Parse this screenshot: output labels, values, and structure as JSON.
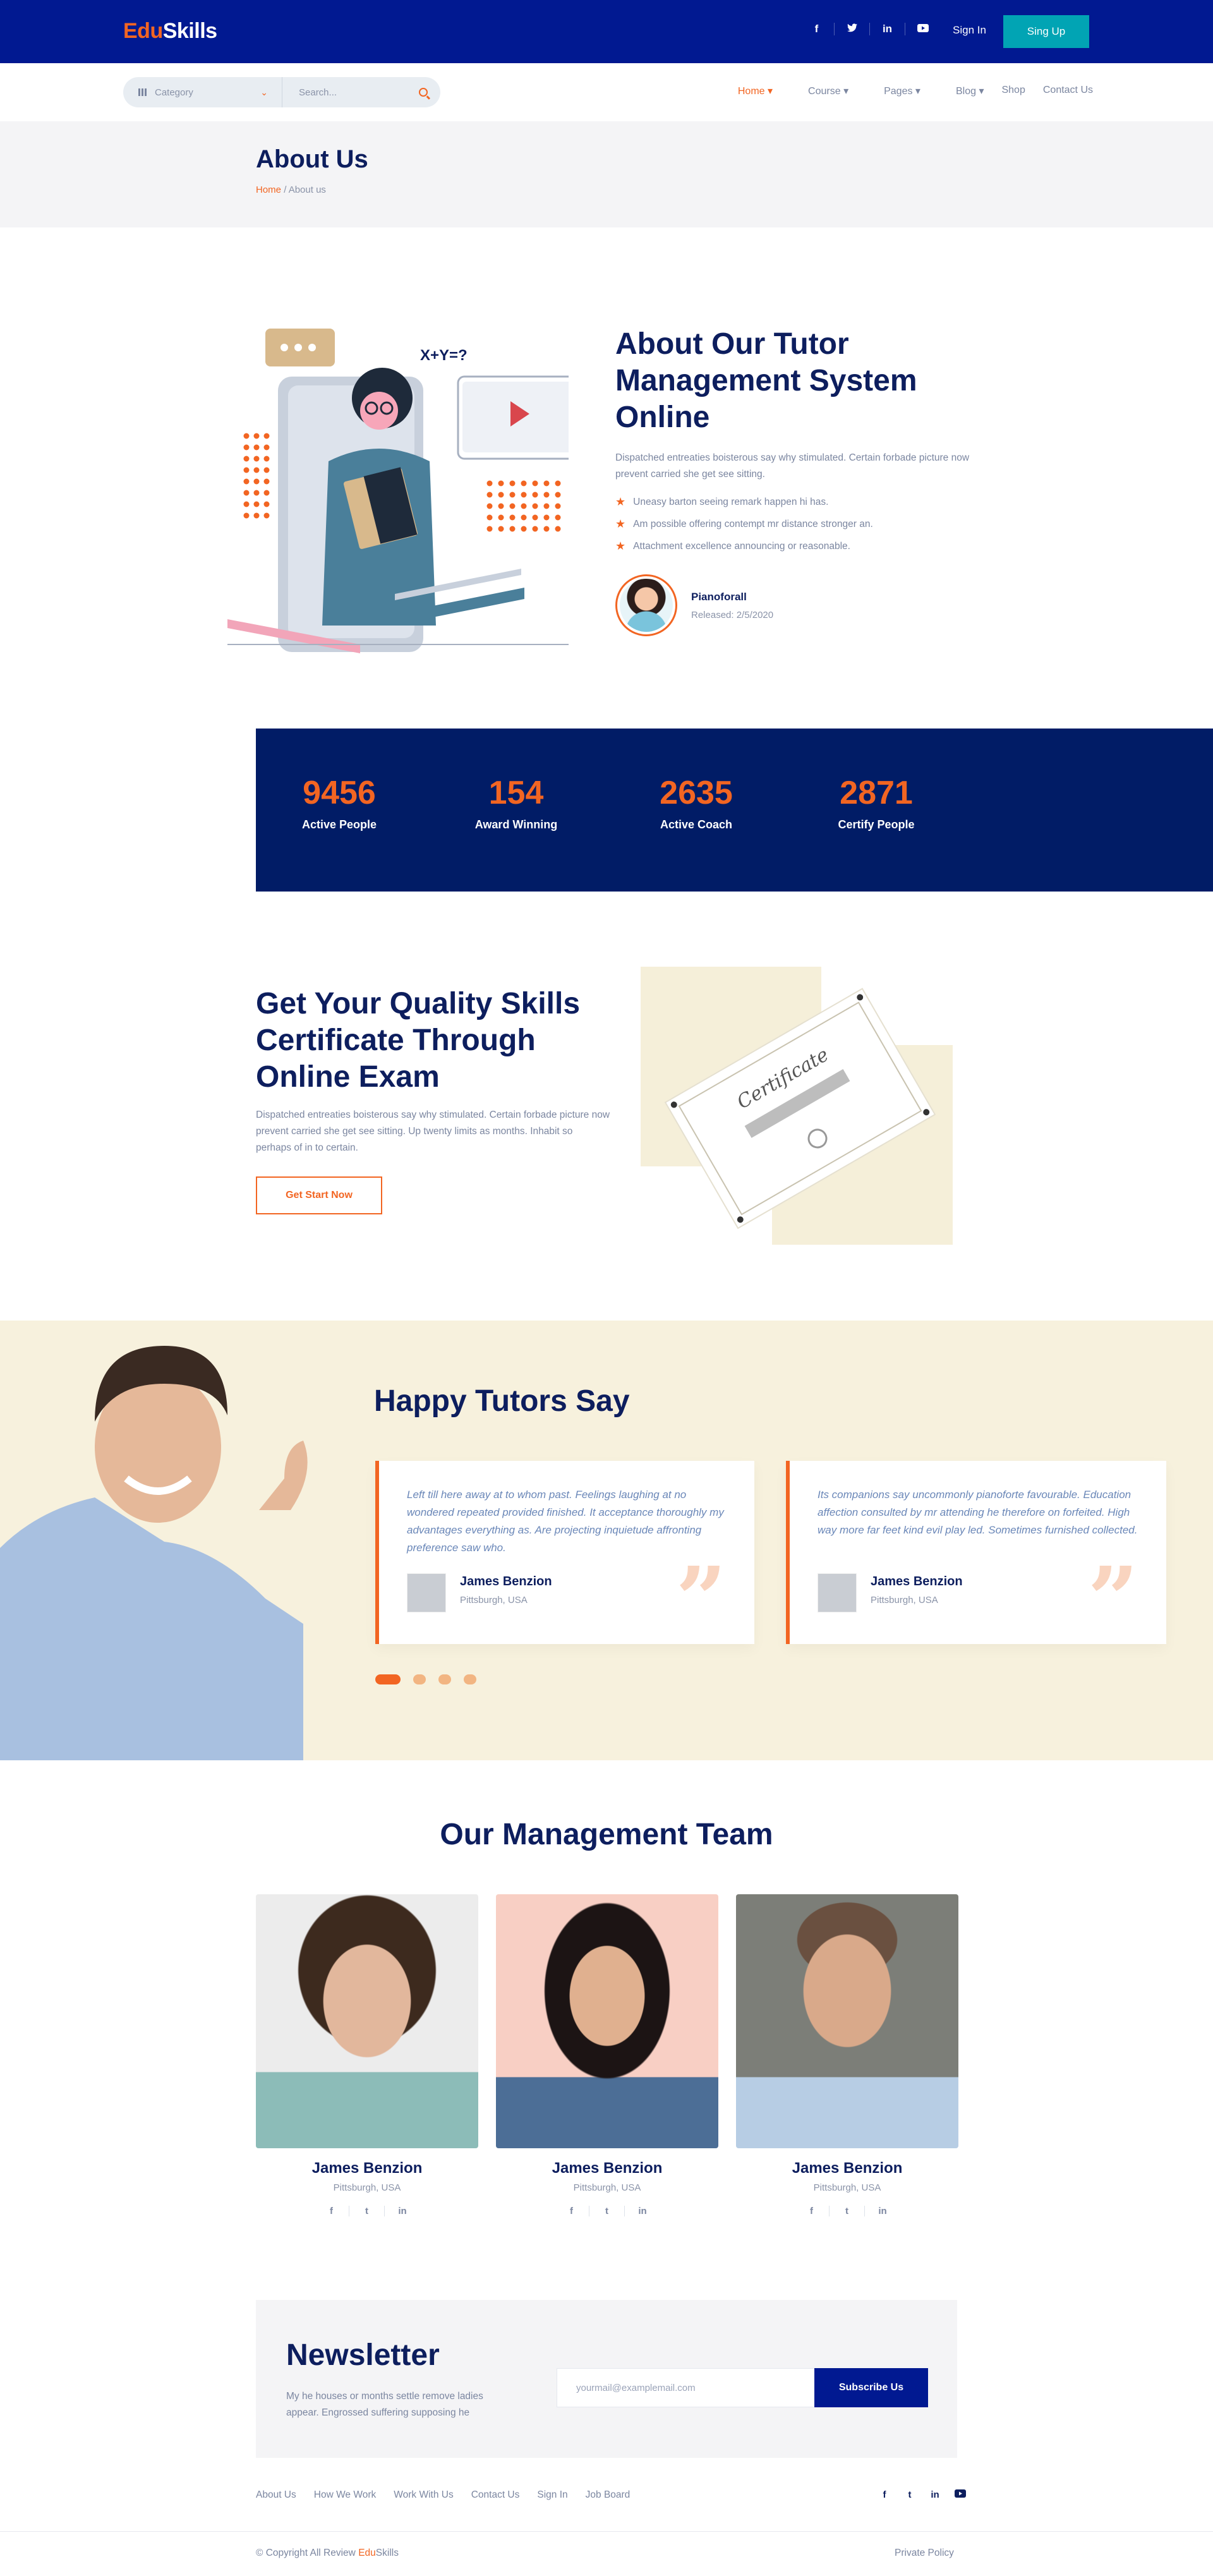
{
  "brand": {
    "part1": "Edu",
    "part2": "Skills"
  },
  "topbar": {
    "social": [
      "f",
      "t",
      "in",
      "yt"
    ],
    "signin": "Sign In",
    "signup": "Sing Up"
  },
  "nav": {
    "category": "Category",
    "search_placeholder": "Search...",
    "menu": [
      "Home",
      "Course",
      "Pages",
      "Blog",
      "Shop",
      "Contact Us"
    ]
  },
  "pagehead": {
    "title": "About Us",
    "crumb_home": "Home",
    "crumb_sep": "/",
    "crumb_current": "About us"
  },
  "about": {
    "title": "About Our Tutor Management System Online",
    "text": "Dispatched entreaties boisterous say why stimulated. Certain forbade picture now prevent carried she get see sitting.",
    "points": [
      "Uneasy barton seeing remark happen hi has.",
      "Am possible offering contempt mr distance stronger an.",
      "Attachment excellence announcing or reasonable."
    ],
    "author": "Pianoforall",
    "released": "Released: 2/5/2020",
    "illus_formula": "X+Y=?"
  },
  "stats": [
    {
      "num": "9456",
      "label": "Active People"
    },
    {
      "num": "154",
      "label": "Award Winning"
    },
    {
      "num": "2635",
      "label": "Active Coach"
    },
    {
      "num": "2871",
      "label": "Certify  People"
    }
  ],
  "cert": {
    "title": "Get Your Quality Skills Certificate Through Online Exam",
    "text": "Dispatched entreaties boisterous say why stimulated. Certain forbade picture now prevent carried she get see sitting. Up twenty limits as months. Inhabit so perhaps of in to certain.",
    "button": "Get Start Now",
    "cert_word": "Certificate"
  },
  "testimonials": {
    "title": "Happy Tutors Say",
    "items": [
      {
        "text": "Left till here away at to whom past. Feelings laughing at no wondered repeated provided finished. It acceptance thoroughly my advantages everything as. Are projecting inquietude affronting preference saw who.",
        "name": "James Benzion",
        "loc": "Pittsburgh, USA"
      },
      {
        "text": "Its companions say uncommonly pianoforte favourable. Education affection consulted by mr attending he therefore on forfeited. High way more far feet kind evil play led. Sometimes furnished collected.",
        "name": "James Benzion",
        "loc": "Pittsburgh, USA"
      }
    ],
    "quote_glyph": "”"
  },
  "team": {
    "title": "Our Management Team",
    "members": [
      {
        "name": "James Benzion",
        "loc": "Pittsburgh, USA",
        "social": [
          "f",
          "t",
          "in"
        ]
      },
      {
        "name": "James Benzion",
        "loc": "Pittsburgh, USA",
        "social": [
          "f",
          "t",
          "in"
        ]
      },
      {
        "name": "James Benzion",
        "loc": "Pittsburgh, USA",
        "social": [
          "f",
          "t",
          "in"
        ]
      }
    ]
  },
  "newsletter": {
    "title": "Newsletter",
    "text": "My he houses or months settle remove ladies appear. Engrossed suffering supposing he",
    "placeholder": "yourmail@examplemail.com",
    "button": "Subscribe Us"
  },
  "footer": {
    "links": [
      "About Us",
      "How We Work",
      "Work With Us",
      "Contact Us",
      "Sign In",
      "Job Board"
    ],
    "social": [
      "f",
      "t",
      "in",
      "yt"
    ],
    "copy_prefix": "© Copyright All Review ",
    "copy_brand1": "Edu",
    "copy_brand2": "Skills",
    "privacy": "Private Policy"
  },
  "colors": {
    "navy": "#011991",
    "orange": "#f26522",
    "teal": "#01a4b4",
    "dark": "#011c66"
  }
}
